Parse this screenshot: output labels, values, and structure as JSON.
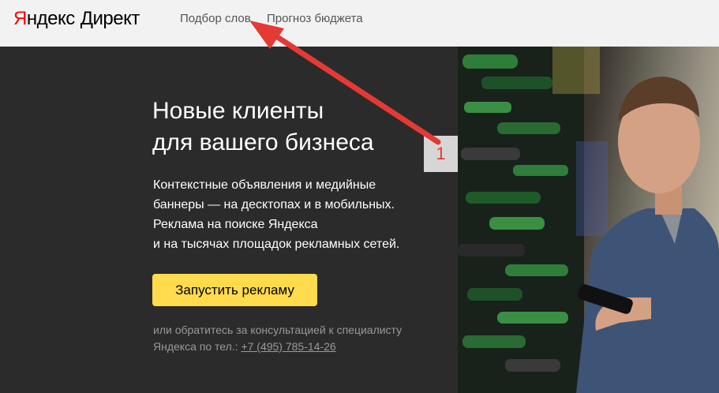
{
  "header": {
    "logo_brand": "Яндекс",
    "logo_product": "Директ",
    "nav": [
      "Подбор слов",
      "Прогноз бюджета"
    ]
  },
  "hero": {
    "headline_line1": "Новые клиенты",
    "headline_line2": "для вашего бизнеса",
    "desc_lines": [
      "Контекстные объявления и медийные",
      "баннеры — на десктопах и в мобильных.",
      "Реклама на поиске Яндекса",
      "и на тысячах площадок рекламных сетей."
    ],
    "cta_label": "Запустить рекламу",
    "contact_line1": "или обратитесь за консультацией к специалисту",
    "contact_prefix": "Яндекса по тел.: ",
    "contact_phone": "+7 (495) 785-14-26"
  },
  "annotation": {
    "marker_label": "1",
    "arrow_color": "#e53935"
  },
  "colors": {
    "header_bg": "#f2f2f2",
    "hero_bg": "#2b2b2b",
    "cta_bg": "#ffdb4d",
    "logo_red": "#ff0000"
  }
}
